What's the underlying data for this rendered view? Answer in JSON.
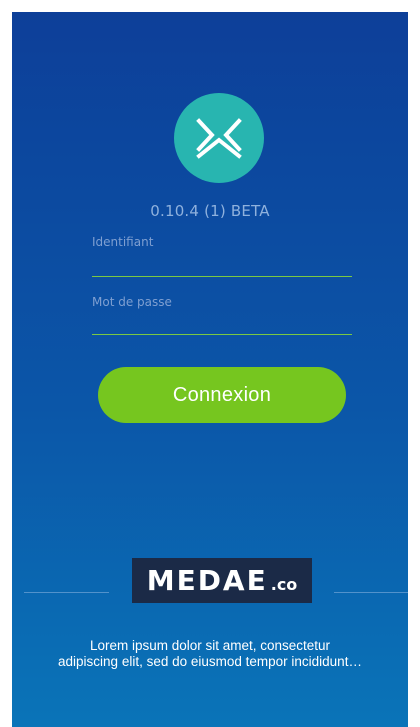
{
  "app": {
    "version": "0.10.4 (1) BETA"
  },
  "logo": {
    "icon": "mx-logo-icon",
    "color": "#28b5b0"
  },
  "form": {
    "username_label": "Identifiant",
    "username_value": "",
    "password_label": "Mot de passe",
    "password_value": "",
    "login_button": "Connexion",
    "accent_color": "#76c61f"
  },
  "brand": {
    "name": "MEDAE",
    "suffix": ".co"
  },
  "description": {
    "line1": "Lorem ipsum dolor sit amet, consectetur",
    "line2": "adipiscing elit, sed do eiusmod tempor incididunt…"
  }
}
